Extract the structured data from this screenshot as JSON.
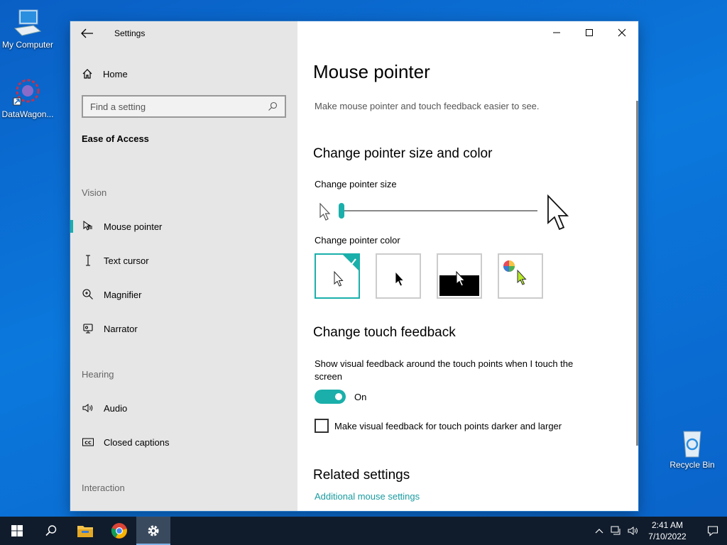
{
  "desktop": {
    "icons": [
      {
        "label": "My Computer",
        "icon": "computer-icon"
      },
      {
        "label": "DataWagon...",
        "icon": "datawagon-shortcut-icon"
      },
      {
        "label": "Recycle Bin",
        "icon": "recycle-bin-icon"
      }
    ]
  },
  "window": {
    "title": "Settings",
    "controls": {
      "minimize": "minimize-icon",
      "maximize": "maximize-icon",
      "close": "close-icon"
    }
  },
  "sidebar": {
    "home_label": "Home",
    "search_placeholder": "Find a setting",
    "section_title": "Ease of Access",
    "groups": {
      "vision": "Vision",
      "hearing": "Hearing",
      "interaction": "Interaction"
    },
    "items": [
      {
        "label": "Mouse pointer",
        "icon": "mouse-pointer-icon",
        "active": true
      },
      {
        "label": "Text cursor",
        "icon": "text-cursor-icon"
      },
      {
        "label": "Magnifier",
        "icon": "magnifier-icon"
      },
      {
        "label": "Narrator",
        "icon": "narrator-icon"
      },
      {
        "label": "Audio",
        "icon": "audio-icon"
      },
      {
        "label": "Closed captions",
        "icon": "closed-captions-icon"
      }
    ]
  },
  "main": {
    "title": "Mouse pointer",
    "subtitle": "Make mouse pointer and touch feedback easier to see.",
    "size_color_heading": "Change pointer size and color",
    "size_label": "Change pointer size",
    "size_value": 1,
    "color_label": "Change pointer color",
    "color_options": [
      "white",
      "black",
      "inverted",
      "custom"
    ],
    "color_selected": "white",
    "touch_heading": "Change touch feedback",
    "touch_desc": "Show visual feedback around the touch points when I touch the screen",
    "touch_toggle_state": "On",
    "darker_checkbox_label": "Make visual feedback for touch points darker and larger",
    "darker_checked": false,
    "related_heading": "Related settings",
    "related_link": "Additional mouse settings"
  },
  "taskbar": {
    "time": "2:41 AM",
    "date": "7/10/2022",
    "apps": [
      "start-icon",
      "search-icon",
      "file-explorer-icon",
      "chrome-icon",
      "settings-gear-icon"
    ],
    "active_app": "settings-gear-icon"
  },
  "colors": {
    "accent": "#1aafaa",
    "link": "#1a9ba0",
    "sidebar_bg": "#e6e6e6",
    "taskbar_bg": "#101c2c"
  }
}
